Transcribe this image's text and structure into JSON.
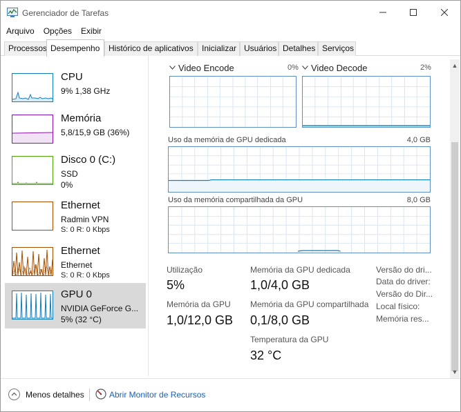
{
  "window": {
    "title": "Gerenciador de Tarefas"
  },
  "menu": [
    "Arquivo",
    "Opções",
    "Exibir"
  ],
  "tabs": [
    "Processos",
    "Desempenho",
    "Histórico de aplicativos",
    "Inicializar",
    "Usuários",
    "Detalhes",
    "Serviços"
  ],
  "active_tab": "Desempenho",
  "left_items": [
    {
      "title": "CPU",
      "line1": "9%  1,38 GHz",
      "line2": "",
      "color": "#117dbb"
    },
    {
      "title": "Memória",
      "line1": "5,8/15,9 GB (36%)",
      "line2": "",
      "color": "#8b12ae"
    },
    {
      "title": "Disco 0 (C:)",
      "line1": "SSD",
      "line2": "0%",
      "color": "#4da60c"
    },
    {
      "title": "Ethernet",
      "line1": "Radmin VPN",
      "line2": "S: 0  R: 0 Kbps",
      "color": "#a74f01"
    },
    {
      "title": "Ethernet",
      "line1": "Ethernet",
      "line2": "S: 0  R: 0 Kbps",
      "color": "#a74f01"
    },
    {
      "title": "GPU 0",
      "line1": "NVIDIA GeForce G...",
      "line2": "5%  (32 °C)",
      "color": "#117dbb"
    }
  ],
  "gpu": {
    "engine_left": {
      "name": "Video Encode",
      "percent": "0%"
    },
    "engine_right": {
      "name": "Video Decode",
      "percent": "2%"
    },
    "dedicated_label": "Uso da memória de GPU dedicada",
    "dedicated_max": "4,0 GB",
    "shared_label": "Uso da memória compartilhada da GPU",
    "shared_max": "8,0 GB",
    "stats": {
      "utilizacao_label": "Utilização",
      "utilizacao_value": "5%",
      "memoria_gpu_label": "Memória da GPU",
      "memoria_gpu_value": "1,0/12,0 GB",
      "dedicada_label": "Memória da GPU dedicada",
      "dedicada_value": "1,0/4,0 GB",
      "compartilhada_label": "Memória da GPU compartilhada",
      "compartilhada_value": "0,1/8,0 GB",
      "temperatura_label": "Temperatura da GPU",
      "temperatura_value": "32 °C"
    },
    "side_labels": [
      "Versão do dri...",
      "Data do driver:",
      "Versão do Dir...",
      "Local físico:",
      "Memória res..."
    ]
  },
  "footer": {
    "less_details": "Menos detalhes",
    "resource_monitor": "Abrir Monitor de Recursos"
  },
  "colors": {
    "graph_border": "#5e8fc4",
    "grid": "#d9e6f2",
    "link": "#1a5fb4",
    "selected": "#d9d9d9"
  }
}
